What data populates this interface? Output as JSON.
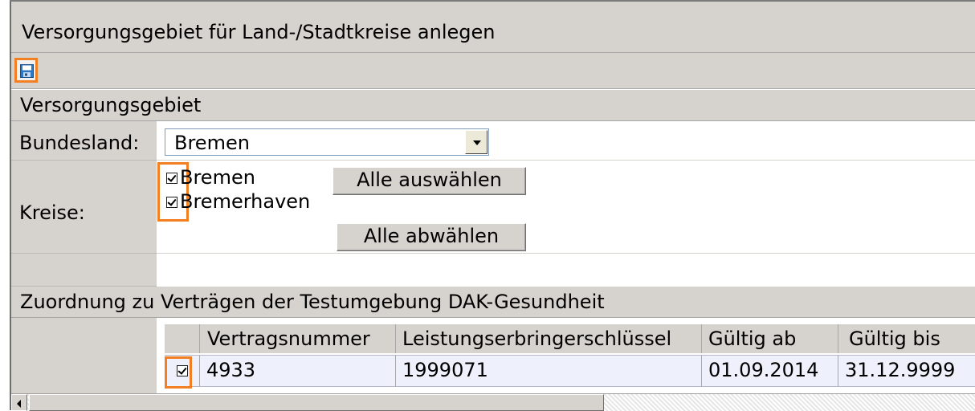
{
  "window": {
    "title": "Versorgungsgebiet für Land-/Stadtkreise anlegen"
  },
  "toolbar": {
    "save_icon": "floppy-disk-icon"
  },
  "versorgungsgebiet": {
    "header": "Versorgungsgebiet",
    "bundesland_label": "Bundesland:",
    "bundesland_value": "Bremen",
    "kreise_label": "Kreise:",
    "kreise": [
      {
        "label": "Bremen",
        "checked": true
      },
      {
        "label": "Bremerhaven",
        "checked": true
      }
    ],
    "select_all_label": "Alle auswählen",
    "deselect_all_label": "Alle abwählen"
  },
  "zuordnung": {
    "header": "Zuordnung zu Verträgen der Testumgebung DAK-Gesundheit",
    "columns": [
      "Vertragsnummer",
      "Leistungserbringerschlüssel",
      "Gültig ab",
      "Gültig bis"
    ],
    "rows": [
      {
        "checked": true,
        "vertragsnummer": "4933",
        "schluessel": "1999071",
        "gueltig_ab": "01.09.2014",
        "gueltig_bis": "31.12.9999"
      }
    ]
  },
  "colors": {
    "highlight": "#f37f23",
    "panel": "#d6d3ce"
  }
}
